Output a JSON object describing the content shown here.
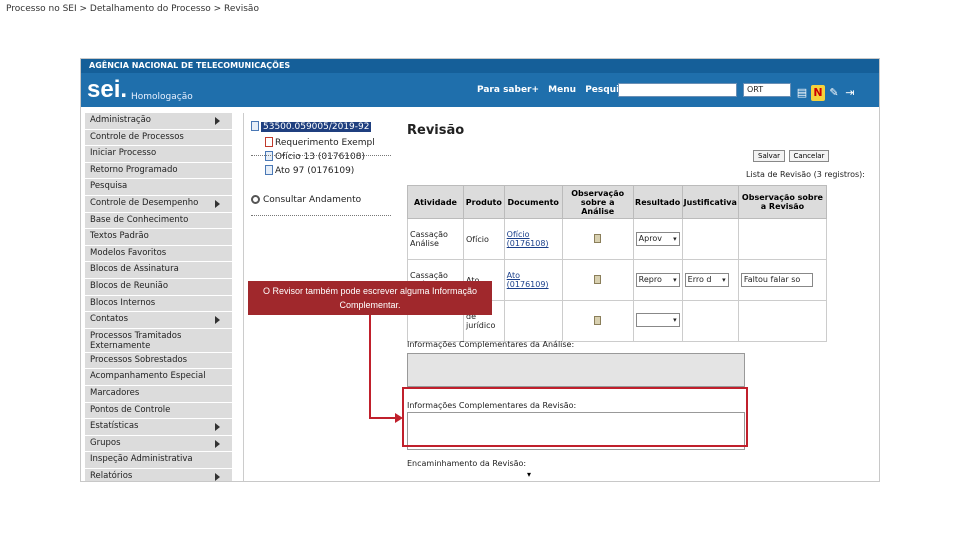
{
  "breadcrumb": "Processo no SEI > Detalhamento do Processo > Revisão",
  "app": {
    "agency": "AGÊNCIA NACIONAL DE TELECOMUNICAÇÕES",
    "logo": "sei.",
    "environment": "Homologação",
    "links": [
      "Para saber+",
      "Menu",
      "Pesquisa"
    ],
    "unit_select": "ORT"
  },
  "menu": [
    {
      "label": "Administração",
      "submenu": true
    },
    {
      "label": "Controle de Processos",
      "submenu": false
    },
    {
      "label": "Iniciar Processo",
      "submenu": false
    },
    {
      "label": "Retorno Programado",
      "submenu": false
    },
    {
      "label": "Pesquisa",
      "submenu": false
    },
    {
      "label": "Controle de Desempenho",
      "submenu": true
    },
    {
      "label": "Base de Conhecimento",
      "submenu": false
    },
    {
      "label": "Textos Padrão",
      "submenu": false
    },
    {
      "label": "Modelos Favoritos",
      "submenu": false
    },
    {
      "label": "Blocos de Assinatura",
      "submenu": false
    },
    {
      "label": "Blocos de Reunião",
      "submenu": false
    },
    {
      "label": "Blocos Internos",
      "submenu": false
    },
    {
      "label": "Contatos",
      "submenu": true
    },
    {
      "label": "Processos Tramitados Externamente",
      "submenu": false
    },
    {
      "label": "Processos Sobrestados",
      "submenu": false
    },
    {
      "label": "Acompanhamento Especial",
      "submenu": false
    },
    {
      "label": "Marcadores",
      "submenu": false
    },
    {
      "label": "Pontos de Controle",
      "submenu": false
    },
    {
      "label": "Estatísticas",
      "submenu": true
    },
    {
      "label": "Grupos",
      "submenu": true
    },
    {
      "label": "Inspeção Administrativa",
      "submenu": false
    },
    {
      "label": "Relatórios",
      "submenu": true
    }
  ],
  "tree": {
    "process": "53500.059005/2019-92",
    "items": [
      "Requerimento Exempl",
      "Ofício 13 (0176108)",
      "Ato 97 (0176109)"
    ],
    "consult": "Consultar Andamento"
  },
  "panel": {
    "title": "Revisão",
    "save": "Salvar",
    "cancel": "Cancelar",
    "list_caption": "Lista de Revisão (3 registros):",
    "headers": [
      "Atividade",
      "Produto",
      "Documento",
      "Observação sobre a Análise",
      "Resultado",
      "Justificativa",
      "Observação sobre a Revisão"
    ],
    "rows": [
      {
        "atividade": "Cassação Análise",
        "produto": "Ofício",
        "documento": "Ofício (0176108)",
        "resultado": "Aprov",
        "justificativa": "",
        "obs": ""
      },
      {
        "atividade": "Cassação Análise com",
        "produto": "Ato",
        "documento": "Ato (0176109)",
        "resultado": "Repro",
        "justificativa": "Erro d",
        "obs": "Faltou falar so"
      },
      {
        "atividade": "",
        "produto": "de jurídico",
        "documento": "",
        "resultado": "",
        "justificativa": "",
        "obs": ""
      }
    ],
    "info_analise_label": "Informações Complementares da Análise:",
    "info_revisao_label": "Informações Complementares da Revisão:",
    "encaminhamento_label": "Encaminhamento da Revisão:"
  },
  "callout": "O Revisor também pode escrever alguma Informação Complementar."
}
